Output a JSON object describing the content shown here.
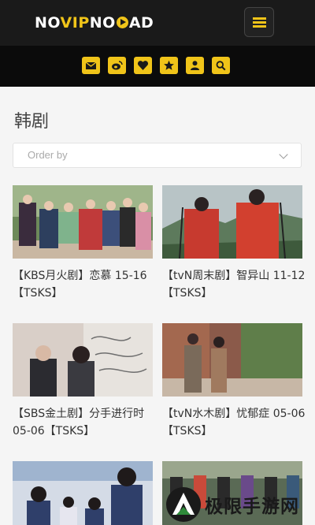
{
  "header": {
    "logo_parts": [
      "NO",
      "VIP",
      "NO",
      "A",
      "D"
    ],
    "menu_icon": "hamburger-icon"
  },
  "icon_bar": [
    "envelope-icon",
    "weibo-icon",
    "heart-icon",
    "star-icon",
    "user-icon",
    "search-icon"
  ],
  "section": {
    "title": "韩剧"
  },
  "sort": {
    "placeholder": "Order by",
    "icon": "chevron-down-icon"
  },
  "cards": [
    {
      "title": "【KBS月火剧】恋慕 15-16【TSKS】"
    },
    {
      "title": "【tvN周末剧】智异山 11-12【TSKS】"
    },
    {
      "title": "【SBS金土剧】分手进行时 05-06【TSKS】"
    },
    {
      "title": "【tvN水木剧】忧郁症 05-06【TSKS】"
    },
    {
      "title": ""
    },
    {
      "title": ""
    }
  ],
  "watermark": {
    "text": "极限手游网"
  },
  "colors": {
    "accent": "#f0c419",
    "header_bg": "#1a1a1a",
    "iconbar_bg": "#0b0b0b",
    "page_bg": "#f5f5f5"
  }
}
